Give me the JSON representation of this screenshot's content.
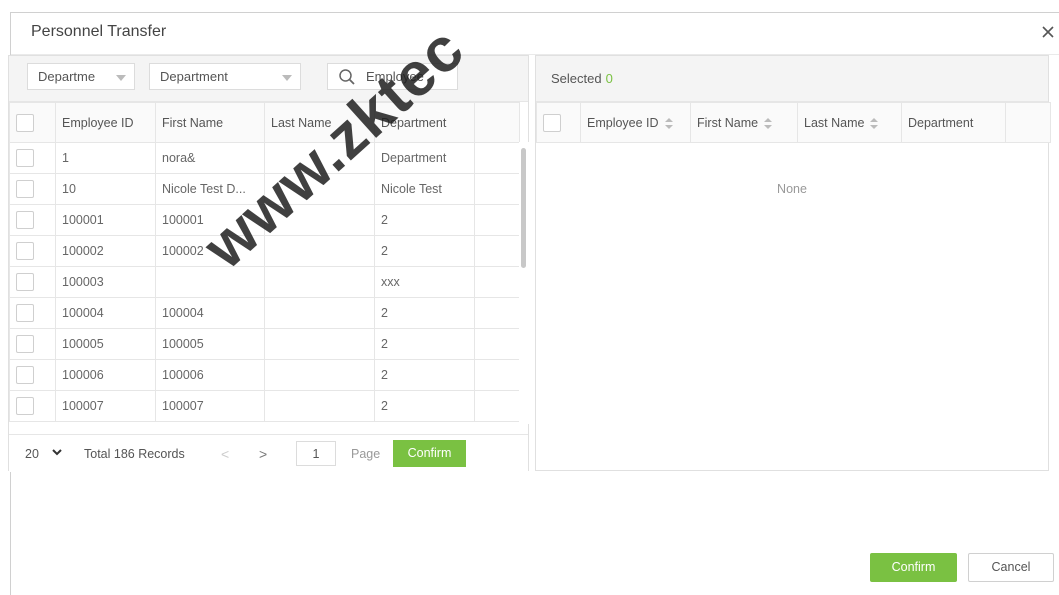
{
  "dialog": {
    "title": "Personnel Transfer",
    "close_icon": "close-icon"
  },
  "filters": {
    "dept_select": "Departme",
    "dept_value": "Department",
    "search_placeholder": "Employee"
  },
  "left_table": {
    "columns": [
      "Employee ID",
      "First Name",
      "Last Name",
      "Department"
    ],
    "rows": [
      {
        "id": "1",
        "first": "nora&",
        "last": "",
        "dept": "Department"
      },
      {
        "id": "10",
        "first": "Nicole Test D...",
        "last": "",
        "dept": "Nicole Test"
      },
      {
        "id": "100001",
        "first": "100001",
        "last": "",
        "dept": "2"
      },
      {
        "id": "100002",
        "first": "100002",
        "last": "",
        "dept": "2"
      },
      {
        "id": "100003",
        "first": "",
        "last": "",
        "dept": "xxx"
      },
      {
        "id": "100004",
        "first": "100004",
        "last": "",
        "dept": "2"
      },
      {
        "id": "100005",
        "first": "100005",
        "last": "",
        "dept": "2"
      },
      {
        "id": "100006",
        "first": "100006",
        "last": "",
        "dept": "2"
      },
      {
        "id": "100007",
        "first": "100007",
        "last": "",
        "dept": "2"
      }
    ]
  },
  "pager": {
    "page_size": "20",
    "total": "Total 186 Records",
    "prev": "<",
    "next": ">",
    "page": "1",
    "page_label": "Page",
    "confirm": "Confirm"
  },
  "right_panel": {
    "selected_label": "Selected",
    "selected_count": "0",
    "columns": [
      "Employee ID",
      "First Name",
      "Last Name",
      "Department"
    ],
    "empty_text": "None"
  },
  "footer": {
    "confirm": "Confirm",
    "cancel": "Cancel"
  },
  "watermark": "www.zktec",
  "colors": {
    "accent": "#7ac142",
    "border": "#e0e0e0",
    "toolbar_bg": "#f4f4f4"
  }
}
